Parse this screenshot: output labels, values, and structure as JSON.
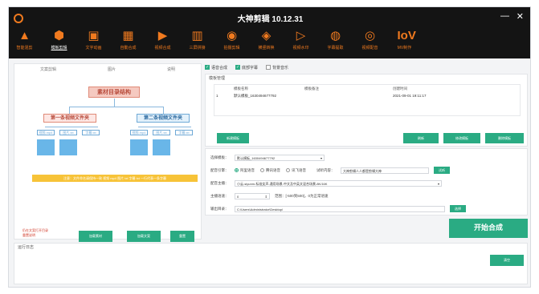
{
  "app": {
    "title": "大神剪辑 10.12.31",
    "minimize": "—",
    "close": "✕"
  },
  "toolbar": [
    {
      "label": "智能混剪",
      "icon": "triangle-icon"
    },
    {
      "label": "模板剪辑",
      "icon": "hexagon-icon",
      "active": true
    },
    {
      "label": "文字动画",
      "icon": "image-icon"
    },
    {
      "label": "自動合成",
      "icon": "grid-icon"
    },
    {
      "label": "视频合成",
      "icon": "play-icon"
    },
    {
      "label": "三屏拼接",
      "icon": "columns-icon"
    },
    {
      "label": "拍摄剪辑",
      "icon": "film-icon"
    },
    {
      "label": "横竖转换",
      "icon": "rotate-icon"
    },
    {
      "label": "视频水印",
      "icon": "play2-icon"
    },
    {
      "label": "字幕提取",
      "icon": "subtitle-icon"
    },
    {
      "label": "视频配音",
      "icon": "voice-icon"
    },
    {
      "label": "MV制作",
      "icon": "mv-icon",
      "glyph": "IoV"
    }
  ],
  "left": {
    "tabs": [
      "文案剪辑",
      "图片",
      "说明"
    ],
    "diagram": {
      "root": "素材目录结构",
      "folder1": "第一条视频文件夹",
      "folder2": "第二条视频文件夹",
      "chips1": [
        "视频.mp4",
        "图片.txt",
        "字幕.txt"
      ],
      "chips2": [
        "视频.mp4",
        "图片.txt",
        "字幕.txt"
      ],
      "banner": "注意：文件命名请保持一致  视频 mp4 图片 txt 字幕 txt 一行代表一条字幕"
    },
    "hint1": "仍在文案打开目录",
    "hint2": "重置说明",
    "buttons": [
      "加载素材",
      "加载文案",
      "重置"
    ]
  },
  "checks": [
    {
      "label": "语音合成",
      "on": true
    },
    {
      "label": "底部字幕",
      "on": true
    },
    {
      "label": "背景音乐",
      "on": false
    }
  ],
  "template_mgr": {
    "title": "模板管理",
    "columns": [
      "模板名称",
      "模板备注",
      "创建时间"
    ],
    "rows": [
      [
        "1",
        "默认模板_1630494677792",
        "",
        "2021-09-01 19:11:17"
      ]
    ],
    "add_button": "新建模板",
    "buttons": [
      "刷新",
      "修改模板",
      "删除模板"
    ]
  },
  "form": {
    "template_label": "选择模板：",
    "template_value": "默认模板_1630494677792",
    "engine_label": "配音引擎：",
    "engines": [
      {
        "label": "阿里语音",
        "on": true
      },
      {
        "label": "腾讯语音",
        "on": false
      },
      {
        "label": "讯飞语音",
        "on": false
      }
    ],
    "test_label": "试听内容：",
    "test_value": "大神剪辑人人都是剪辑大神",
    "test_button": "试听",
    "voice_label": "配音主播：",
    "voice_value": "小云-siyunm-标准女声-通用场景-中文及中英文混合场景-8K/16K",
    "speed_label": "主播语速：",
    "speed_value": "0",
    "speed_hint": "范围：[-500到500]，0为正常语速",
    "output_label": "输出目录：",
    "output_value": "C:\\Users\\Administrator\\Desktop\\",
    "output_button": "选择"
  },
  "start_button": "开始合成",
  "log": {
    "title": "运行日志",
    "clear_button": "清空"
  },
  "colors": {
    "accent": "#2aab83",
    "brand": "#f07a1f",
    "titlebar": "#141414"
  }
}
